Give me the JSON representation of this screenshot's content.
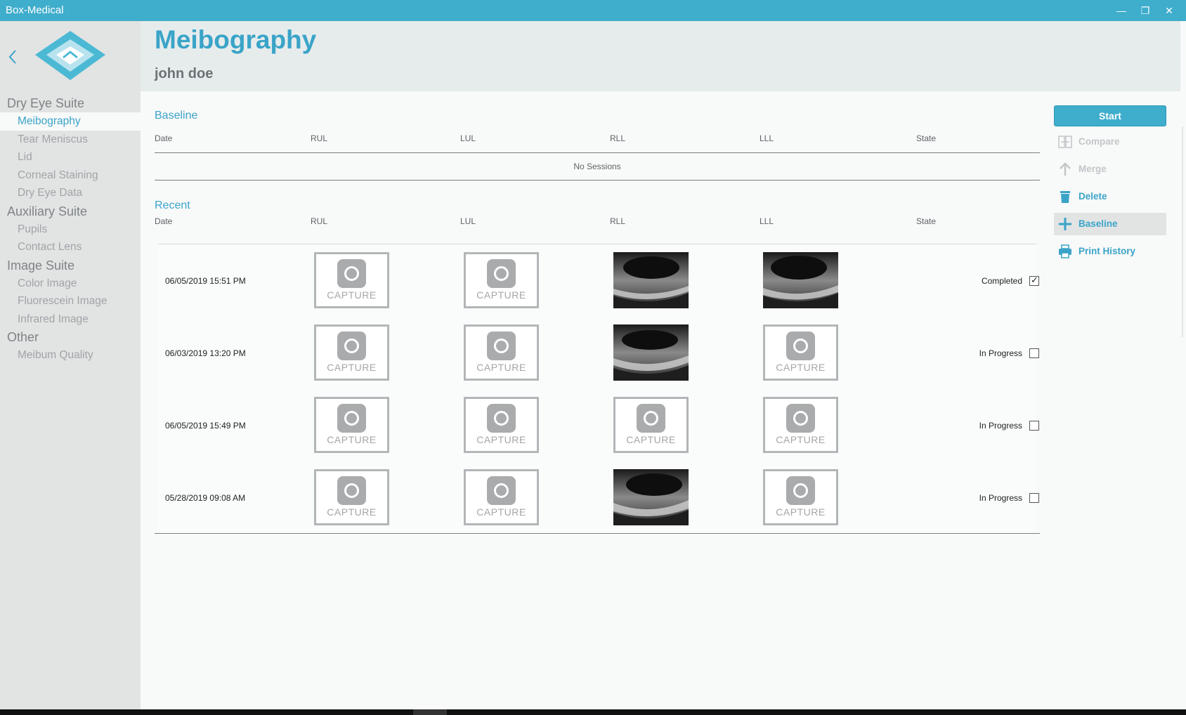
{
  "window": {
    "title": "Box-Medical",
    "minimize": "—",
    "restore": "❐",
    "close": "✕"
  },
  "sidebar": {
    "back_icon": "chevron-left-icon",
    "sections": [
      {
        "label": "Dry Eye Suite",
        "items": [
          {
            "label": "Meibography",
            "active": true
          },
          {
            "label": "Tear Meniscus"
          },
          {
            "label": "Lid"
          },
          {
            "label": "Corneal Staining"
          },
          {
            "label": "Dry Eye Data"
          }
        ]
      },
      {
        "label": "Auxiliary Suite",
        "items": [
          {
            "label": "Pupils"
          },
          {
            "label": "Contact Lens"
          }
        ]
      },
      {
        "label": "Image Suite",
        "items": [
          {
            "label": "Color Image"
          },
          {
            "label": "Fluorescein Image"
          },
          {
            "label": "Infrared Image"
          }
        ]
      },
      {
        "label": "Other",
        "items": [
          {
            "label": "Meibum Quality"
          }
        ]
      }
    ]
  },
  "header": {
    "title": "Meibography",
    "patient": "john doe"
  },
  "columns": [
    "Date",
    "RUL",
    "LUL",
    "RLL",
    "LLL",
    "State"
  ],
  "baseline": {
    "title": "Baseline",
    "empty_text": "No Sessions"
  },
  "recent": {
    "title": "Recent",
    "capture_label": "CAPTURE",
    "rows": [
      {
        "date": "06/05/2019 15:51 PM",
        "images": [
          "capture",
          "capture",
          "photo",
          "photo"
        ],
        "state": "Completed",
        "checked": true
      },
      {
        "date": "06/03/2019 13:20 PM",
        "images": [
          "capture",
          "capture",
          "photo",
          "capture"
        ],
        "state": "In Progress",
        "checked": false
      },
      {
        "date": "06/05/2019 15:49 PM",
        "images": [
          "capture",
          "capture",
          "capture",
          "capture"
        ],
        "state": "In Progress",
        "checked": false
      },
      {
        "date": "05/28/2019 09:08 AM",
        "images": [
          "capture",
          "capture",
          "photo",
          "capture"
        ],
        "state": "In Progress",
        "checked": false
      }
    ]
  },
  "actions": {
    "start": "Start",
    "items": [
      {
        "label": "Compare",
        "icon": "compare-icon",
        "enabled": false
      },
      {
        "label": "Merge",
        "icon": "merge-icon",
        "enabled": false
      },
      {
        "label": "Delete",
        "icon": "trash-icon",
        "enabled": true
      },
      {
        "label": "Baseline",
        "icon": "plus-icon",
        "enabled": true,
        "highlight": true
      },
      {
        "label": "Print History",
        "icon": "printer-icon",
        "enabled": true
      }
    ]
  },
  "colors": {
    "accent": "#3fadcc",
    "accent_text": "#3aa4c8",
    "sidebar_bg": "#e2e3e3",
    "header_bg": "#e6ecec"
  }
}
